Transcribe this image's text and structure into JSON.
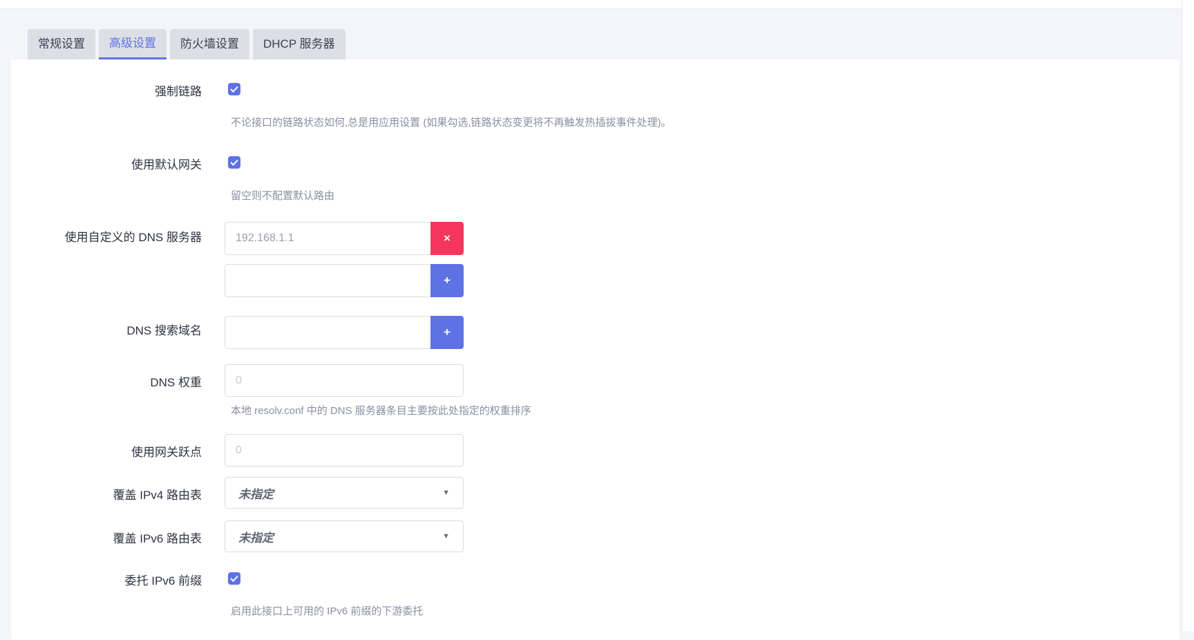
{
  "tabs": [
    {
      "label": "常规设置",
      "active": false
    },
    {
      "label": "高级设置",
      "active": true
    },
    {
      "label": "防火墙设置",
      "active": false
    },
    {
      "label": "DHCP 服务器",
      "active": false
    }
  ],
  "form": {
    "force_link": {
      "label": "强制链路",
      "checked": true,
      "description": "不论接口的链路状态如何,总是用应用设置 (如果勾选,链路状态变更将不再触发热插拔事件处理)。"
    },
    "default_gateway": {
      "label": "使用默认网关",
      "checked": true,
      "description": "留空则不配置默认路由"
    },
    "custom_dns": {
      "label": "使用自定义的 DNS 服务器",
      "entries": [
        "192.168.1.1"
      ],
      "new_entry": "",
      "remove_icon": "×",
      "add_icon": "+"
    },
    "dns_search": {
      "label": "DNS 搜索域名",
      "value": "",
      "add_icon": "+"
    },
    "dns_weight": {
      "label": "DNS 权重",
      "placeholder": "0",
      "description": "本地 resolv.conf 中的 DNS 服务器条目主要按此处指定的权重排序"
    },
    "gateway_metric": {
      "label": "使用网关跃点",
      "placeholder": "0"
    },
    "ipv4_table": {
      "label": "覆盖 IPv4 路由表",
      "value": "未指定"
    },
    "ipv6_table": {
      "label": "覆盖 IPv6 路由表",
      "value": "未指定"
    },
    "delegate_ipv6": {
      "label": "委托 IPv6 前缀",
      "checked": true,
      "description": "启用此接口上可用的 IPv6 前缀的下游委托"
    }
  },
  "colors": {
    "accent": "#5e72e4",
    "danger": "#f5365c"
  }
}
